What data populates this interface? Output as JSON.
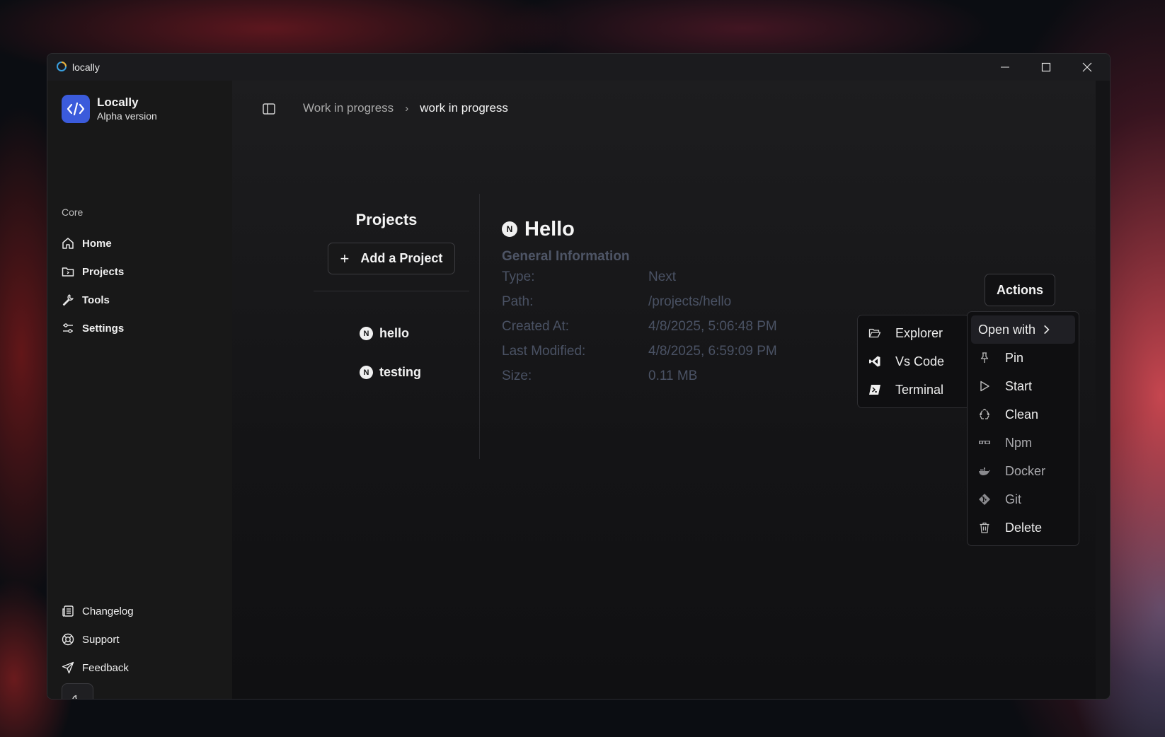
{
  "window": {
    "title": "locally"
  },
  "brand": {
    "name": "Locally",
    "subtitle": "Alpha version"
  },
  "sidebar": {
    "section": "Core",
    "items": [
      {
        "label": "Home",
        "icon": "home-icon"
      },
      {
        "label": "Projects",
        "icon": "folder-icon"
      },
      {
        "label": "Tools",
        "icon": "wrench-icon"
      },
      {
        "label": "Settings",
        "icon": "sliders-icon"
      }
    ],
    "bottom_items": [
      {
        "label": "Changelog",
        "icon": "newspaper-icon"
      },
      {
        "label": "Support",
        "icon": "lifebuoy-icon"
      },
      {
        "label": "Feedback",
        "icon": "send-icon"
      }
    ]
  },
  "breadcrumb": {
    "parent": "Work in progress",
    "current": "work in progress"
  },
  "projects": {
    "title": "Projects",
    "add_label": "Add a Project",
    "list": [
      {
        "name": "hello",
        "icon": "next-logo"
      },
      {
        "name": "testing",
        "icon": "next-logo"
      }
    ]
  },
  "detail": {
    "title": "Hello",
    "section": "General Information",
    "rows": [
      {
        "key": "Type:",
        "value": "Next"
      },
      {
        "key": "Path:",
        "value": "/projects/hello"
      },
      {
        "key": "Created At:",
        "value": "4/8/2025, 5:06:48 PM"
      },
      {
        "key": "Last Modified:",
        "value": "4/8/2025, 6:59:09 PM"
      },
      {
        "key": "Size:",
        "value": "0.11 MB"
      }
    ]
  },
  "actions": {
    "button_label": "Actions",
    "menu": [
      {
        "label": "Open with",
        "icon": "chevron-right-icon"
      },
      {
        "label": "Pin",
        "icon": "pin-icon"
      },
      {
        "label": "Start",
        "icon": "play-icon"
      },
      {
        "label": "Clean",
        "icon": "recycle-icon"
      },
      {
        "label": "Npm",
        "icon": "npm-icon"
      },
      {
        "label": "Docker",
        "icon": "docker-icon"
      },
      {
        "label": "Git",
        "icon": "git-icon"
      },
      {
        "label": "Delete",
        "icon": "trash-icon"
      }
    ],
    "open_with": [
      {
        "label": "Explorer",
        "icon": "folder-open-icon"
      },
      {
        "label": "Vs Code",
        "icon": "vscode-icon"
      },
      {
        "label": "Terminal",
        "icon": "terminal-icon"
      }
    ]
  },
  "colors": {
    "brand": "#3b5bdb",
    "muted_text": "#4a5264"
  }
}
